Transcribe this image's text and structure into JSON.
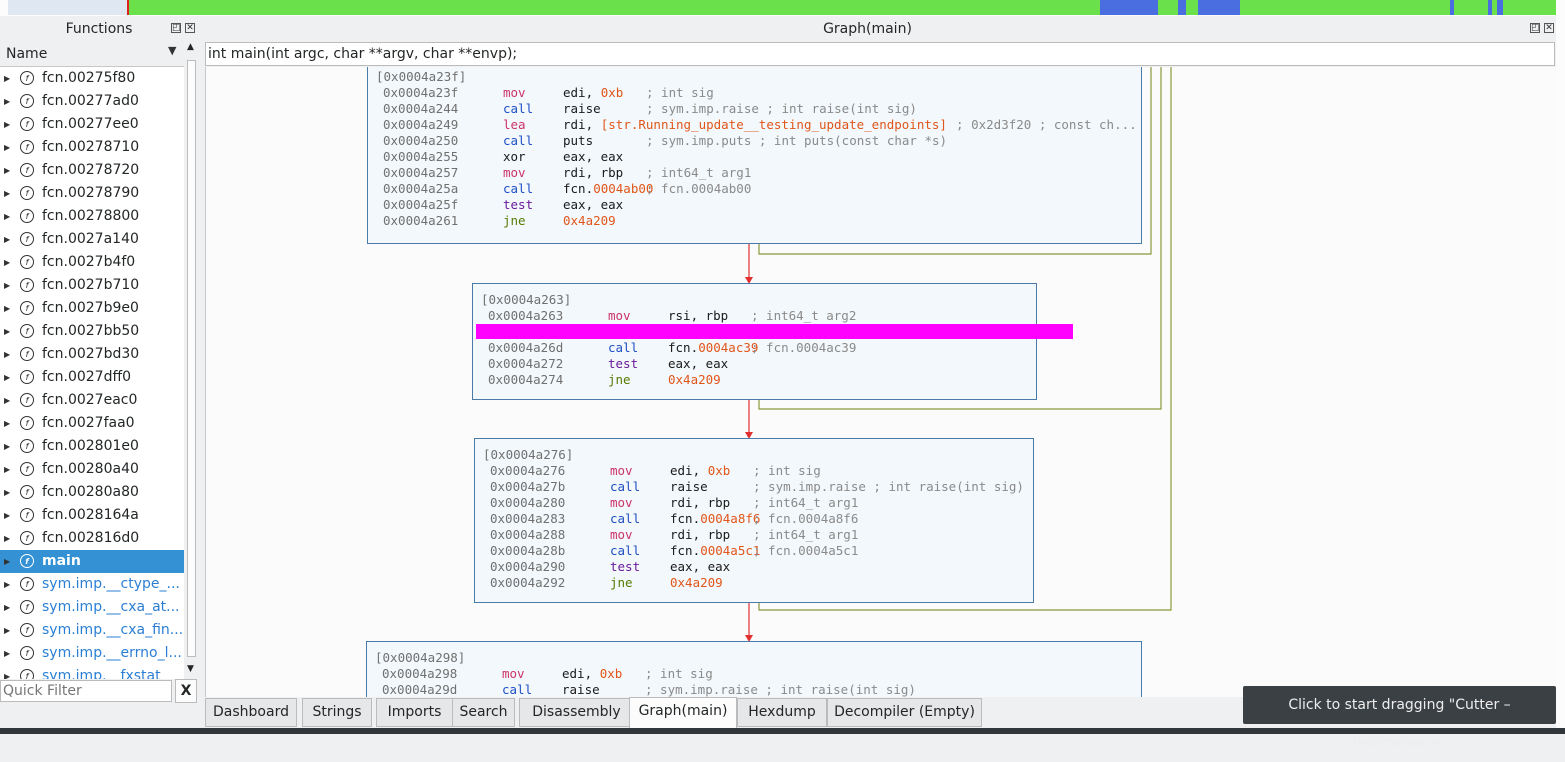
{
  "functions_panel": {
    "title": "Functions",
    "header_label": "Name",
    "items": [
      {
        "name": "fcn.00275f80",
        "kind": "fcn"
      },
      {
        "name": "fcn.00277ad0",
        "kind": "fcn"
      },
      {
        "name": "fcn.00277ee0",
        "kind": "fcn"
      },
      {
        "name": "fcn.00278710",
        "kind": "fcn"
      },
      {
        "name": "fcn.00278720",
        "kind": "fcn"
      },
      {
        "name": "fcn.00278790",
        "kind": "fcn"
      },
      {
        "name": "fcn.00278800",
        "kind": "fcn"
      },
      {
        "name": "fcn.0027a140",
        "kind": "fcn"
      },
      {
        "name": "fcn.0027b4f0",
        "kind": "fcn"
      },
      {
        "name": "fcn.0027b710",
        "kind": "fcn"
      },
      {
        "name": "fcn.0027b9e0",
        "kind": "fcn"
      },
      {
        "name": "fcn.0027bb50",
        "kind": "fcn"
      },
      {
        "name": "fcn.0027bd30",
        "kind": "fcn"
      },
      {
        "name": "fcn.0027dff0",
        "kind": "fcn"
      },
      {
        "name": "fcn.0027eac0",
        "kind": "fcn"
      },
      {
        "name": "fcn.0027faa0",
        "kind": "fcn"
      },
      {
        "name": "fcn.002801e0",
        "kind": "fcn"
      },
      {
        "name": "fcn.00280a40",
        "kind": "fcn"
      },
      {
        "name": "fcn.00280a80",
        "kind": "fcn"
      },
      {
        "name": "fcn.0028164a",
        "kind": "fcn"
      },
      {
        "name": "fcn.002816d0",
        "kind": "fcn"
      },
      {
        "name": "main",
        "kind": "selected"
      },
      {
        "name": "sym.imp.__ctype_...",
        "kind": "sym"
      },
      {
        "name": "sym.imp.__cxa_at...",
        "kind": "sym"
      },
      {
        "name": "sym.imp.__cxa_fin...",
        "kind": "sym"
      },
      {
        "name": "sym.imp.__errno_l...",
        "kind": "sym"
      },
      {
        "name": "sym.imp.__fxstat",
        "kind": "sym"
      }
    ],
    "quick_filter_placeholder": "Quick Filter",
    "clear_label": "X"
  },
  "graph_panel": {
    "title": "Graph(main)",
    "signature": "int main(int argc, char **argv, char **envp);",
    "blocks": [
      {
        "header": "[0x0004a23f]",
        "lines": [
          {
            "addr": "0x0004a23f",
            "mn": "mov",
            "cls": "mov",
            "op": "edi, ",
            "num": "0xb",
            "cm": "; int sig"
          },
          {
            "addr": "0x0004a244",
            "mn": "call",
            "cls": "call",
            "op": "raise",
            "num": "",
            "cm": "; sym.imp.raise ; int raise(int sig)"
          },
          {
            "addr": "0x0004a249",
            "mn": "lea",
            "cls": "lea",
            "op": "rdi, ",
            "num": "[str.Running_update__testing_update_endpoints]",
            "cm": "; 0x2d3f20 ; const ch..."
          },
          {
            "addr": "0x0004a250",
            "mn": "call",
            "cls": "call",
            "op": "puts",
            "num": "",
            "cm": "; sym.imp.puts ; int puts(const char *s)"
          },
          {
            "addr": "0x0004a255",
            "mn": "xor",
            "cls": "xor",
            "op": "eax, eax",
            "num": "",
            "cm": ""
          },
          {
            "addr": "0x0004a257",
            "mn": "mov",
            "cls": "mov",
            "op": "rdi, rbp",
            "num": "",
            "cm": "; int64_t arg1"
          },
          {
            "addr": "0x0004a25a",
            "mn": "call",
            "cls": "call",
            "op": "fcn.",
            "num": "0004ab00",
            "cm": "; fcn.0004ab00"
          },
          {
            "addr": "0x0004a25f",
            "mn": "test",
            "cls": "test",
            "op": "eax, eax",
            "num": "",
            "cm": ""
          },
          {
            "addr": "0x0004a261",
            "mn": "jne",
            "cls": "jne",
            "op": "",
            "num": "0x4a209",
            "cm": ""
          }
        ]
      },
      {
        "header": "[0x0004a263]",
        "lines": [
          {
            "addr": "0x0004a263",
            "mn": "mov",
            "cls": "mov",
            "op": "rsi, rbp",
            "num": "",
            "cm": "; int64_t arg2"
          },
          {
            "addr": "",
            "mn": "",
            "cls": "",
            "op": "",
            "num": "",
            "cm": ""
          },
          {
            "addr": "0x0004a26d",
            "mn": "call",
            "cls": "call",
            "op": "fcn.",
            "num": "0004ac39",
            "cm": "; fcn.0004ac39"
          },
          {
            "addr": "0x0004a272",
            "mn": "test",
            "cls": "test",
            "op": "eax, eax",
            "num": "",
            "cm": ""
          },
          {
            "addr": "0x0004a274",
            "mn": "jne",
            "cls": "jne",
            "op": "",
            "num": "0x4a209",
            "cm": ""
          }
        ]
      },
      {
        "header": "[0x0004a276]",
        "lines": [
          {
            "addr": "0x0004a276",
            "mn": "mov",
            "cls": "mov",
            "op": "edi, ",
            "num": "0xb",
            "cm": "; int sig"
          },
          {
            "addr": "0x0004a27b",
            "mn": "call",
            "cls": "call",
            "op": "raise",
            "num": "",
            "cm": "; sym.imp.raise ; int raise(int sig)"
          },
          {
            "addr": "0x0004a280",
            "mn": "mov",
            "cls": "mov",
            "op": "rdi, rbp",
            "num": "",
            "cm": "; int64_t arg1"
          },
          {
            "addr": "0x0004a283",
            "mn": "call",
            "cls": "call",
            "op": "fcn.",
            "num": "0004a8f6",
            "cm": "; fcn.0004a8f6"
          },
          {
            "addr": "0x0004a288",
            "mn": "mov",
            "cls": "mov",
            "op": "rdi, rbp",
            "num": "",
            "cm": "; int64_t arg1"
          },
          {
            "addr": "0x0004a28b",
            "mn": "call",
            "cls": "call",
            "op": "fcn.",
            "num": "0004a5c1",
            "cm": "; fcn.0004a5c1"
          },
          {
            "addr": "0x0004a290",
            "mn": "test",
            "cls": "test",
            "op": "eax, eax",
            "num": "",
            "cm": ""
          },
          {
            "addr": "0x0004a292",
            "mn": "jne",
            "cls": "jne",
            "op": "",
            "num": "0x4a209",
            "cm": ""
          }
        ]
      },
      {
        "header": "[0x0004a298]",
        "lines": [
          {
            "addr": "0x0004a298",
            "mn": "mov",
            "cls": "mov",
            "op": "edi, ",
            "num": "0xb",
            "cm": "; int sig"
          },
          {
            "addr": "0x0004a29d",
            "mn": "call",
            "cls": "call",
            "op": "raise",
            "num": "",
            "cm": "; sym.imp.raise ; int raise(int sig)"
          }
        ]
      }
    ]
  },
  "tabs": [
    "Dashboard",
    "Strings",
    "Imports",
    "Search",
    "Disassembly",
    "Graph(main)",
    "Hexdump",
    "Decompiler (Empty)"
  ],
  "active_tab": "Graph(main)",
  "tooltip": "Click to start dragging \"Cutter – testmalware\"",
  "colors": {
    "selection": "#3391d4",
    "highlight": "#ff00ff",
    "edge_false": "#e03030",
    "edge_true": "#8a9a3a",
    "overview_green": "#6ae04a",
    "overview_blue": "#4a6ee0"
  }
}
